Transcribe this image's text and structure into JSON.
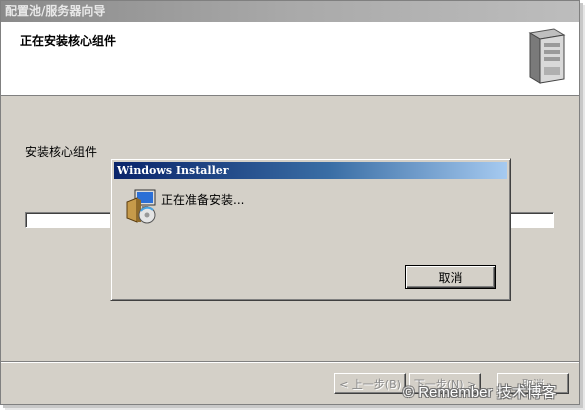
{
  "window": {
    "title": "配置池/服务器向导"
  },
  "header": {
    "title": "正在安装核心组件",
    "icon": "server-tower-icon"
  },
  "content": {
    "label": "安装核心组件"
  },
  "buttons": {
    "back": "< 上一步(B)",
    "next": "下一步(N) >",
    "cancel": "取消"
  },
  "dialog": {
    "title": "Windows Installer",
    "message": "正在准备安装...",
    "icon": "installer-package-icon",
    "cancel": "取消"
  },
  "watermark": "© Remember 技术博客",
  "colors": {
    "dialog_title_start": "#0a246a",
    "dialog_title_end": "#a6caf0",
    "face": "#d4d0c8"
  }
}
